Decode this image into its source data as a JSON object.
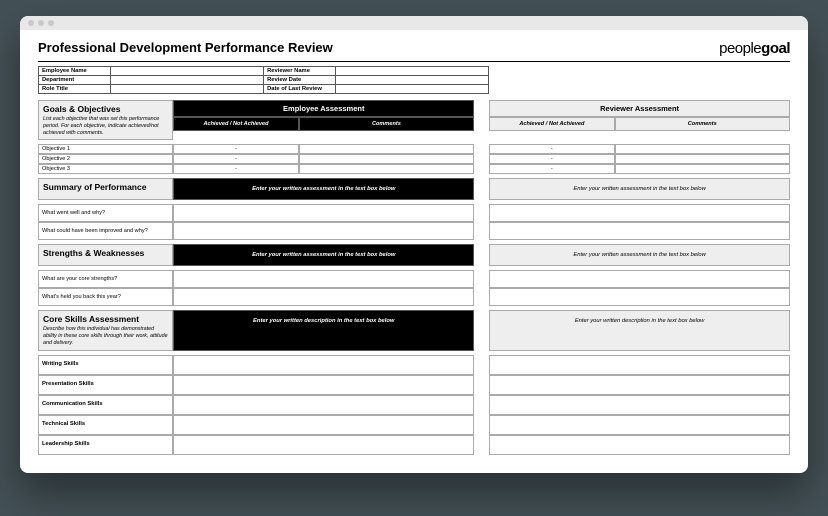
{
  "brand": {
    "part1": "people",
    "part2": "goal"
  },
  "title": "Professional Development Performance Review",
  "info": {
    "r1l": "Employee Name",
    "r1r": "Reviewer Name",
    "r2l": "Department",
    "r2r": "Review Date",
    "r3l": "Role Title",
    "r3r": "Date of Last Review"
  },
  "cols": {
    "emp": "Employee Assessment",
    "rev": "Reviewer Assessment",
    "ach": "Achieved / Not Achieved",
    "com": "Comments"
  },
  "goals": {
    "heading": "Goals & Objectives",
    "desc": "List each objective that was set this performance period. For each objective, indicate achieved/not achieved with comments.",
    "items": [
      "Objective 1",
      "Objective 2",
      "Objective 3"
    ],
    "dash": "-"
  },
  "summary": {
    "heading": "Summary of Performance",
    "promptBlack": "Enter your written assessment in the text box below",
    "promptGray": "Enter your written assessment in the text box below",
    "q1": "What went well and why?",
    "q2": "What could have been improved and why?"
  },
  "sw": {
    "heading": "Strengths & Weaknesses",
    "promptBlack": "Enter your written assessment in the text box below",
    "promptGray": "Enter your written assessment in the text box below",
    "q1": "What are your core strengths?",
    "q2": "What's held you back this year?"
  },
  "core": {
    "heading": "Core Skills Assessment",
    "desc": "Describe how this individual has demonstrated ability in these core skills through their work, attitude and delivery.",
    "promptBlack": "Enter your written description in the text box below",
    "promptGray": "Enter your written description in the text box below",
    "skills": [
      "Writing Skills",
      "Presentation Skills",
      "Communication Skills",
      "Technical Skills",
      "Leadership Skills"
    ]
  }
}
